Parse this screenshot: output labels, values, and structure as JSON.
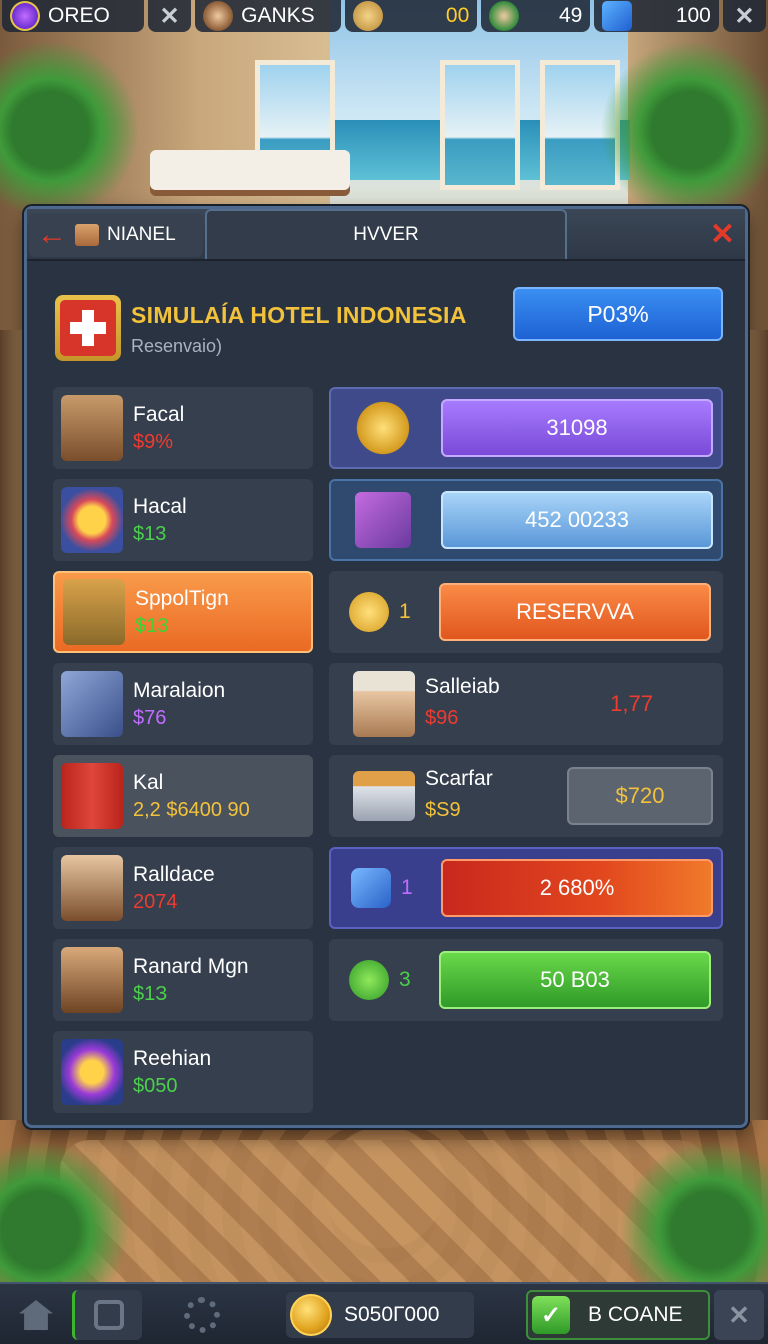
{
  "hud": {
    "player_name": "OREO",
    "team_name": "GANKS",
    "gold": "00",
    "level": "49",
    "gems": "100"
  },
  "panel": {
    "back_tab_label": "NIANEL",
    "active_tab_label": "HVVER",
    "hotel_title": "SIMULAÍA HOTEL INDONESIA",
    "hotel_subtitle": "Resenvaio)",
    "progress_label": "P03%"
  },
  "left_items": [
    {
      "name": "Facal",
      "value": "$9%",
      "color": "red"
    },
    {
      "name": "Hacal",
      "value": "$13",
      "color": "green"
    },
    {
      "name": "SppolTign",
      "value": "$13",
      "color": "green"
    },
    {
      "name": "Maralaion",
      "value": "$76",
      "color": "purple"
    },
    {
      "name": "Kal",
      "value": "2,2 $6400 90",
      "color": "yellow"
    },
    {
      "name": "Ralldace",
      "value": "2074",
      "color": "red"
    },
    {
      "name": "Ranard Mgn",
      "value": "$1З",
      "color": "green"
    },
    {
      "name": "Reehian",
      "value": "$050",
      "color": "green"
    }
  ],
  "right_items": [
    {
      "bar_label": "31098"
    },
    {
      "bar_label": "452 00233"
    },
    {
      "count": "1",
      "bar_label": "RESERVVA"
    },
    {
      "name": "Salleiab",
      "value": "$96",
      "side_value": "1,77"
    },
    {
      "name": "Scarfar",
      "value": "$S9",
      "bar_label": "$720"
    },
    {
      "count": "1",
      "bar_label": "2 680%"
    },
    {
      "count": "3",
      "bar_label": "50 B03"
    }
  ],
  "bottom": {
    "coins": "S050Г000",
    "done_label": "B COANE"
  },
  "colors": {
    "panel_bg": "#2a3341",
    "accent_orange": "#ea6a24",
    "accent_blue": "#1e62d4",
    "accent_green": "#3fb52e",
    "accent_red": "#d8352a",
    "gold": "#f2c23a"
  }
}
